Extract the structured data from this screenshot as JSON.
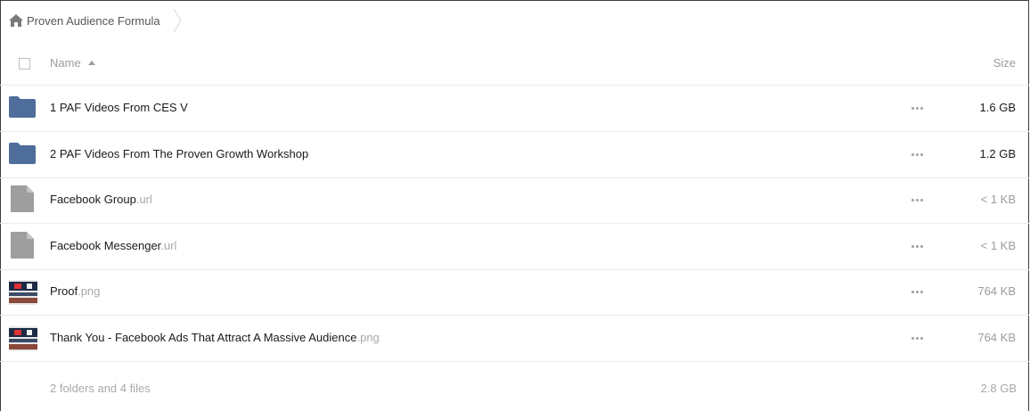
{
  "breadcrumb": {
    "label": "Proven Audience Formula",
    "icon": "home-icon"
  },
  "header": {
    "name_label": "Name",
    "size_label": "Size"
  },
  "colors": {
    "folder": "#4f6d9a",
    "file_generic": "#9e9e9e"
  },
  "files": [
    {
      "icon": "folder-icon",
      "name": "1 PAF Videos From CES V",
      "ext": "",
      "size": "1.6 GB",
      "size_style": "dark"
    },
    {
      "icon": "folder-icon",
      "name": "2 PAF Videos From The Proven Growth Workshop",
      "ext": "",
      "size": "1.2 GB",
      "size_style": "dark"
    },
    {
      "icon": "file-icon",
      "name": "Facebook Group",
      "ext": ".url",
      "size": "< 1 KB",
      "size_style": "light"
    },
    {
      "icon": "file-icon",
      "name": "Facebook Messenger",
      "ext": ".url",
      "size": "< 1 KB",
      "size_style": "light"
    },
    {
      "icon": "image-thumbnail",
      "name": "Proof",
      "ext": ".png",
      "size": "764 KB",
      "size_style": "light"
    },
    {
      "icon": "image-thumbnail",
      "name": "Thank You - Facebook Ads That Attract A Massive Audience",
      "ext": ".png",
      "size": "764 KB",
      "size_style": "light"
    }
  ],
  "footer": {
    "summary": "2 folders and 4 files",
    "total_size": "2.8 GB"
  }
}
